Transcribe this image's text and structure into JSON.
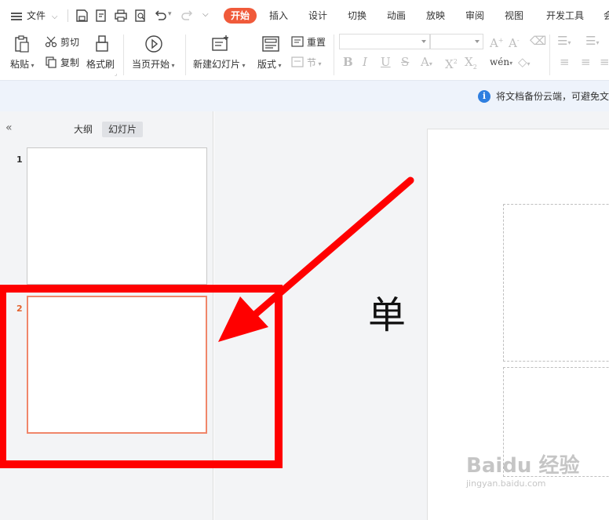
{
  "menubar": {
    "file_label": "文件",
    "tabs": [
      {
        "label": "开始",
        "active": true
      },
      {
        "label": "插入"
      },
      {
        "label": "设计"
      },
      {
        "label": "切换"
      },
      {
        "label": "动画"
      },
      {
        "label": "放映"
      },
      {
        "label": "审阅"
      },
      {
        "label": "视图"
      },
      {
        "label": "开发工具"
      },
      {
        "label": "会"
      }
    ]
  },
  "ribbon": {
    "paste_label": "粘贴",
    "cut_label": "剪切",
    "copy_label": "复制",
    "format_painter_label": "格式刷",
    "from_current_label": "当页开始",
    "new_slide_label": "新建幻灯片",
    "layout_label": "版式",
    "reset_label": "重置",
    "section_label": "节"
  },
  "notification": {
    "text": "将文档备份云端，可避免文"
  },
  "left_pane": {
    "tabs": [
      {
        "label": "大纲",
        "active": false
      },
      {
        "label": "幻灯片",
        "active": true
      }
    ],
    "slides": [
      {
        "number": "1",
        "selected": false
      },
      {
        "number": "2",
        "selected": true
      }
    ]
  },
  "canvas": {
    "slide_title_char": "单"
  },
  "watermark": {
    "main": "Baidu 经验",
    "sub": "jingyan.baidu.com"
  },
  "colors": {
    "accent": "#f05a3a",
    "selected_thumb_border": "#f0866a",
    "annotation": "#ff0000",
    "info": "#2f7fe0"
  }
}
